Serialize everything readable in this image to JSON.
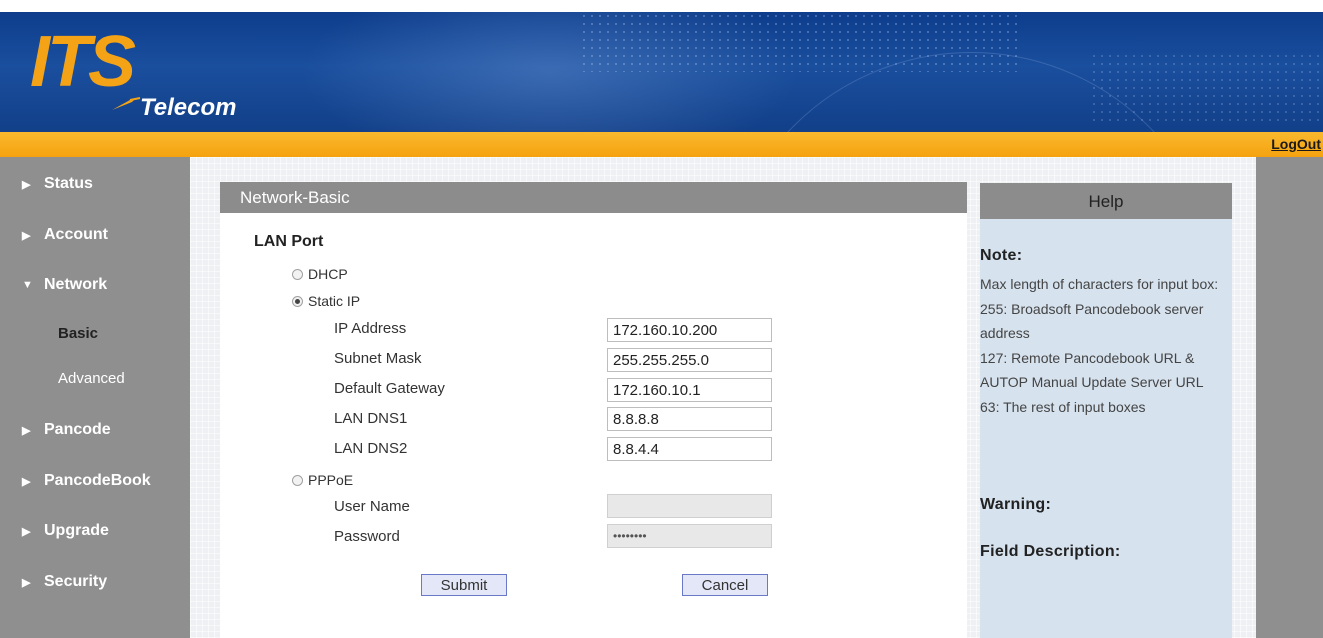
{
  "brand": {
    "logo_main": "ITS",
    "logo_sub": "Telecom",
    "accent_color": "#f5a316"
  },
  "topbar": {
    "logout_label": "LogOut"
  },
  "sidebar": {
    "items": [
      {
        "label": "Status",
        "expanded": false
      },
      {
        "label": "Account",
        "expanded": false
      },
      {
        "label": "Network",
        "expanded": true
      },
      {
        "label": "Pancode",
        "expanded": false
      },
      {
        "label": "PancodeBook",
        "expanded": false
      },
      {
        "label": "Upgrade",
        "expanded": false
      },
      {
        "label": "Security",
        "expanded": false
      }
    ],
    "network_sub": [
      {
        "label": "Basic",
        "active": true
      },
      {
        "label": "Advanced",
        "active": false
      }
    ]
  },
  "panel": {
    "title": "Network-Basic",
    "section": "LAN Port",
    "options": {
      "dhcp": "DHCP",
      "static": "Static IP",
      "pppoe": "PPPoE"
    },
    "selected_mode": "Static IP",
    "static_fields": [
      {
        "label": "IP Address",
        "value": "172.160.10.200"
      },
      {
        "label": "Subnet Mask",
        "value": "255.255.255.0"
      },
      {
        "label": "Default Gateway",
        "value": "172.160.10.1"
      },
      {
        "label": "LAN DNS1",
        "value": "8.8.8.8"
      },
      {
        "label": "LAN DNS2",
        "value": "8.8.4.4"
      }
    ],
    "pppoe_fields": [
      {
        "label": "User Name",
        "value": ""
      },
      {
        "label": "Password",
        "value": "••••••••"
      }
    ],
    "submit_label": "Submit",
    "cancel_label": "Cancel"
  },
  "help": {
    "title": "Help",
    "note_heading": "Note:",
    "note_lines": [
      "Max length of characters for input box:",
      "255: Broadsoft Pancodebook server address",
      "127: Remote Pancodebook URL & AUTOP Manual Update Server URL",
      "63: The rest of input boxes"
    ],
    "warning_heading": "Warning:",
    "field_desc_heading": "Field Description:"
  }
}
